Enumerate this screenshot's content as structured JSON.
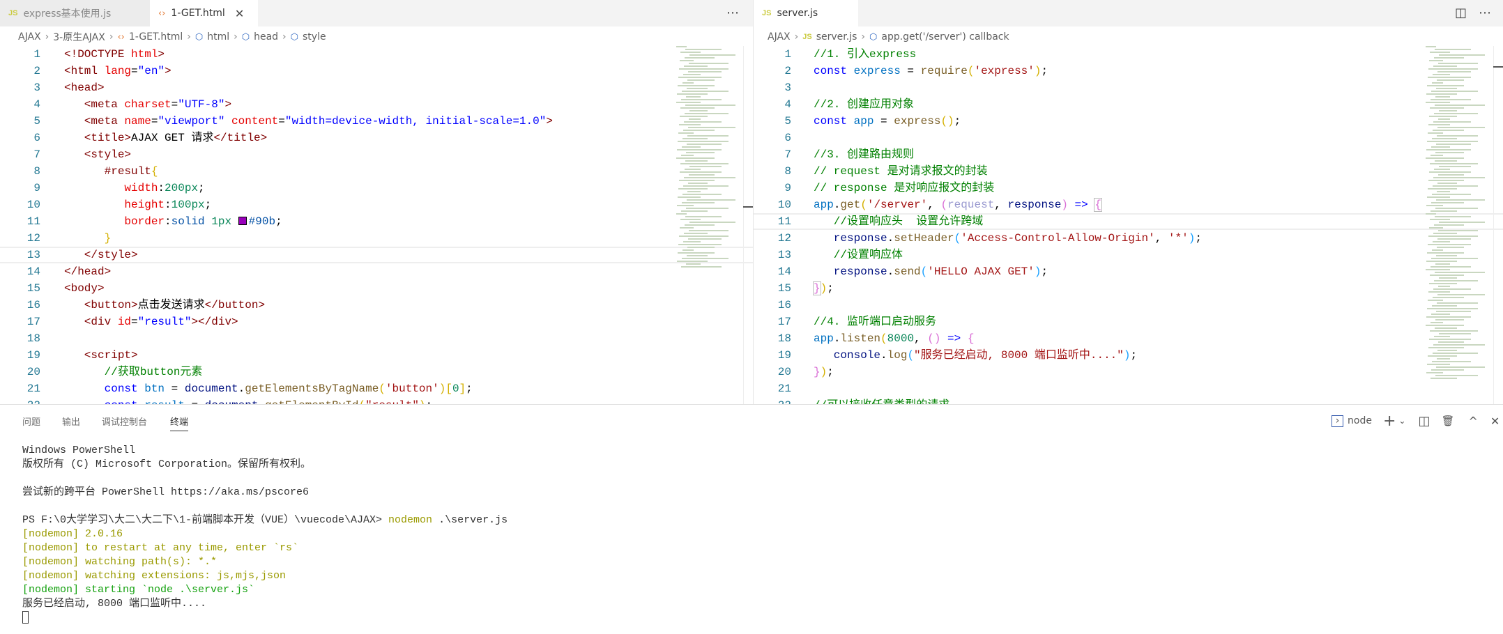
{
  "left_editor": {
    "tabs": [
      {
        "label": "express基本使用.js",
        "icon": "js-icon",
        "active": false
      },
      {
        "label": "1-GET.html",
        "icon": "html-icon",
        "active": true
      }
    ],
    "breadcrumb": [
      "AJAX",
      "3-原生AJAX",
      "1-GET.html",
      "html",
      "head",
      "style"
    ],
    "current_line": 13,
    "lines": [
      {
        "n": "1",
        "tokens": [
          {
            "t": "<!DOCTYPE ",
            "c": "tag"
          },
          {
            "t": "html",
            "c": "attr"
          },
          {
            "t": ">",
            "c": "tag"
          }
        ]
      },
      {
        "n": "2",
        "tokens": [
          {
            "t": "<html ",
            "c": "tag"
          },
          {
            "t": "lang",
            "c": "attr"
          },
          {
            "t": "=",
            "c": "txtc"
          },
          {
            "t": "\"en\"",
            "c": "val"
          },
          {
            "t": ">",
            "c": "tag"
          }
        ]
      },
      {
        "n": "3",
        "tokens": [
          {
            "t": "<head>",
            "c": "tag"
          }
        ]
      },
      {
        "n": "4",
        "tokens": [
          {
            "t": "   <meta ",
            "c": "tag"
          },
          {
            "t": "charset",
            "c": "attr"
          },
          {
            "t": "=",
            "c": "txtc"
          },
          {
            "t": "\"UTF-8\"",
            "c": "val"
          },
          {
            "t": ">",
            "c": "tag"
          }
        ]
      },
      {
        "n": "5",
        "tokens": [
          {
            "t": "   <meta ",
            "c": "tag"
          },
          {
            "t": "name",
            "c": "attr"
          },
          {
            "t": "=",
            "c": "txtc"
          },
          {
            "t": "\"viewport\"",
            "c": "val"
          },
          {
            "t": " content",
            "c": "attr"
          },
          {
            "t": "=",
            "c": "txtc"
          },
          {
            "t": "\"width=device-width, initial-scale=1.0\"",
            "c": "val"
          },
          {
            "t": ">",
            "c": "tag"
          }
        ]
      },
      {
        "n": "6",
        "tokens": [
          {
            "t": "   <title>",
            "c": "tag"
          },
          {
            "t": "AJAX GET 请求",
            "c": "txtc"
          },
          {
            "t": "</title>",
            "c": "tag"
          }
        ]
      },
      {
        "n": "7",
        "tokens": [
          {
            "t": "   <style>",
            "c": "tag"
          }
        ]
      },
      {
        "n": "8",
        "tokens": [
          {
            "t": "      #result",
            "c": "tag"
          },
          {
            "t": "{",
            "c": "b1"
          }
        ]
      },
      {
        "n": "9",
        "tokens": [
          {
            "t": "         width",
            "c": "attr"
          },
          {
            "t": ":",
            "c": "txtc"
          },
          {
            "t": "200px",
            "c": "num"
          },
          {
            "t": ";",
            "c": "txtc"
          }
        ]
      },
      {
        "n": "10",
        "tokens": [
          {
            "t": "         height",
            "c": "attr"
          },
          {
            "t": ":",
            "c": "txtc"
          },
          {
            "t": "100px",
            "c": "num"
          },
          {
            "t": ";",
            "c": "txtc"
          }
        ]
      },
      {
        "n": "11",
        "tokens": [
          {
            "t": "         border",
            "c": "attr"
          },
          {
            "t": ":",
            "c": "txtc"
          },
          {
            "t": "solid ",
            "c": "cval"
          },
          {
            "t": "1px ",
            "c": "num"
          },
          {
            "t": "",
            "c": "swatch",
            "color": "#9900bb"
          },
          {
            "t": "#90b",
            "c": "cval"
          },
          {
            "t": ";",
            "c": "txtc"
          }
        ]
      },
      {
        "n": "12",
        "tokens": [
          {
            "t": "      }",
            "c": "b1"
          }
        ]
      },
      {
        "n": "13",
        "tokens": [
          {
            "t": "   </style>",
            "c": "tag"
          }
        ]
      },
      {
        "n": "14",
        "tokens": [
          {
            "t": "</head>",
            "c": "tag"
          }
        ]
      },
      {
        "n": "15",
        "tokens": [
          {
            "t": "<body>",
            "c": "tag"
          }
        ]
      },
      {
        "n": "16",
        "tokens": [
          {
            "t": "   <button>",
            "c": "tag"
          },
          {
            "t": "点击发送请求",
            "c": "txtc"
          },
          {
            "t": "</button>",
            "c": "tag"
          }
        ]
      },
      {
        "n": "17",
        "tokens": [
          {
            "t": "   <div ",
            "c": "tag"
          },
          {
            "t": "id",
            "c": "attr"
          },
          {
            "t": "=",
            "c": "txtc"
          },
          {
            "t": "\"result\"",
            "c": "val"
          },
          {
            "t": "></div>",
            "c": "tag"
          }
        ]
      },
      {
        "n": "18",
        "tokens": []
      },
      {
        "n": "19",
        "tokens": [
          {
            "t": "   <script>",
            "c": "tag"
          }
        ]
      },
      {
        "n": "20",
        "tokens": [
          {
            "t": "      //获取button元素",
            "c": "cmt"
          }
        ]
      },
      {
        "n": "21",
        "tokens": [
          {
            "t": "      const",
            "c": "kw"
          },
          {
            "t": " btn",
            "c": "cvar"
          },
          {
            "t": " = ",
            "c": "txtc"
          },
          {
            "t": "document",
            "c": "var"
          },
          {
            "t": ".",
            "c": "txtc"
          },
          {
            "t": "getElementsByTagName",
            "c": "fn"
          },
          {
            "t": "(",
            "c": "b1"
          },
          {
            "t": "'button'",
            "c": "str"
          },
          {
            "t": ")",
            "c": "b1"
          },
          {
            "t": "[",
            "c": "b1"
          },
          {
            "t": "0",
            "c": "num"
          },
          {
            "t": "]",
            "c": "b1"
          },
          {
            "t": ";",
            "c": "txtc"
          }
        ]
      },
      {
        "n": "22",
        "tokens": [
          {
            "t": "      const",
            "c": "kw"
          },
          {
            "t": " result",
            "c": "cvar"
          },
          {
            "t": " = ",
            "c": "txtc"
          },
          {
            "t": "document",
            "c": "var"
          },
          {
            "t": ".",
            "c": "txtc"
          },
          {
            "t": "getElementById",
            "c": "fn"
          },
          {
            "t": "(",
            "c": "b1"
          },
          {
            "t": "\"result\"",
            "c": "str"
          },
          {
            "t": ")",
            "c": "b1"
          },
          {
            "t": ";",
            "c": "txtc"
          }
        ]
      }
    ]
  },
  "right_editor": {
    "tabs": [
      {
        "label": "server.js",
        "icon": "js-icon",
        "active": true,
        "unsaved": true
      }
    ],
    "breadcrumb": [
      "AJAX",
      "server.js",
      "app.get('/server') callback"
    ],
    "current_line": 11,
    "lines": [
      {
        "n": "1",
        "tokens": [
          {
            "t": "//1. 引入express",
            "c": "cmt"
          }
        ]
      },
      {
        "n": "2",
        "tokens": [
          {
            "t": "const",
            "c": "kw"
          },
          {
            "t": " express",
            "c": "cvar"
          },
          {
            "t": " = ",
            "c": "txtc"
          },
          {
            "t": "require",
            "c": "fn"
          },
          {
            "t": "(",
            "c": "b1"
          },
          {
            "t": "'express'",
            "c": "str"
          },
          {
            "t": ")",
            "c": "b1"
          },
          {
            "t": ";",
            "c": "txtc"
          }
        ]
      },
      {
        "n": "3",
        "tokens": []
      },
      {
        "n": "4",
        "tokens": [
          {
            "t": "//2. 创建应用对象",
            "c": "cmt"
          }
        ]
      },
      {
        "n": "5",
        "tokens": [
          {
            "t": "const",
            "c": "kw"
          },
          {
            "t": " app",
            "c": "cvar"
          },
          {
            "t": " = ",
            "c": "txtc"
          },
          {
            "t": "express",
            "c": "fn"
          },
          {
            "t": "()",
            "c": "b1"
          },
          {
            "t": ";",
            "c": "txtc"
          }
        ]
      },
      {
        "n": "6",
        "tokens": []
      },
      {
        "n": "7",
        "tokens": [
          {
            "t": "//3. 创建路由规则",
            "c": "cmt"
          }
        ]
      },
      {
        "n": "8",
        "tokens": [
          {
            "t": "// request 是对请求报文的封装",
            "c": "cmt"
          }
        ]
      },
      {
        "n": "9",
        "tokens": [
          {
            "t": "// response 是对响应报文的封装",
            "c": "cmt"
          }
        ]
      },
      {
        "n": "10",
        "tokens": [
          {
            "t": "app",
            "c": "cvar"
          },
          {
            "t": ".",
            "c": "txtc"
          },
          {
            "t": "get",
            "c": "fn"
          },
          {
            "t": "(",
            "c": "b1"
          },
          {
            "t": "'/server'",
            "c": "str"
          },
          {
            "t": ", ",
            "c": "txtc"
          },
          {
            "t": "(",
            "c": "b2"
          },
          {
            "t": "request",
            "c": "unused"
          },
          {
            "t": ", ",
            "c": "txtc"
          },
          {
            "t": "response",
            "c": "var"
          },
          {
            "t": ")",
            "c": "b2"
          },
          {
            "t": " => ",
            "c": "kw"
          },
          {
            "t": "{",
            "c": "b2 box"
          }
        ]
      },
      {
        "n": "11",
        "tokens": [
          {
            "t": "   //设置响应头  设置允许跨域",
            "c": "cmt"
          }
        ]
      },
      {
        "n": "12",
        "tokens": [
          {
            "t": "   response",
            "c": "var"
          },
          {
            "t": ".",
            "c": "txtc"
          },
          {
            "t": "setHeader",
            "c": "fn"
          },
          {
            "t": "(",
            "c": "b3"
          },
          {
            "t": "'Access-Control-Allow-Origin'",
            "c": "str"
          },
          {
            "t": ", ",
            "c": "txtc"
          },
          {
            "t": "'*'",
            "c": "str"
          },
          {
            "t": ")",
            "c": "b3"
          },
          {
            "t": ";",
            "c": "txtc"
          }
        ]
      },
      {
        "n": "13",
        "tokens": [
          {
            "t": "   //设置响应体",
            "c": "cmt"
          }
        ]
      },
      {
        "n": "14",
        "tokens": [
          {
            "t": "   response",
            "c": "var"
          },
          {
            "t": ".",
            "c": "txtc"
          },
          {
            "t": "send",
            "c": "fn"
          },
          {
            "t": "(",
            "c": "b3"
          },
          {
            "t": "'HELLO AJAX GET'",
            "c": "str"
          },
          {
            "t": ")",
            "c": "b3"
          },
          {
            "t": ";",
            "c": "txtc"
          }
        ]
      },
      {
        "n": "15",
        "tokens": [
          {
            "t": "}",
            "c": "b2 box"
          },
          {
            "t": ")",
            "c": "b1"
          },
          {
            "t": ";",
            "c": "txtc"
          }
        ]
      },
      {
        "n": "16",
        "tokens": []
      },
      {
        "n": "17",
        "tokens": [
          {
            "t": "//4. 监听端口启动服务",
            "c": "cmt"
          }
        ]
      },
      {
        "n": "18",
        "tokens": [
          {
            "t": "app",
            "c": "cvar"
          },
          {
            "t": ".",
            "c": "txtc"
          },
          {
            "t": "listen",
            "c": "fn"
          },
          {
            "t": "(",
            "c": "b1"
          },
          {
            "t": "8000",
            "c": "num"
          },
          {
            "t": ", ",
            "c": "txtc"
          },
          {
            "t": "()",
            "c": "b2"
          },
          {
            "t": " => ",
            "c": "kw"
          },
          {
            "t": "{",
            "c": "b2"
          }
        ]
      },
      {
        "n": "19",
        "tokens": [
          {
            "t": "   console",
            "c": "var"
          },
          {
            "t": ".",
            "c": "txtc"
          },
          {
            "t": "log",
            "c": "fn"
          },
          {
            "t": "(",
            "c": "b3"
          },
          {
            "t": "\"服务已经启动, 8000 端口监听中....\"",
            "c": "str"
          },
          {
            "t": ")",
            "c": "b3"
          },
          {
            "t": ";",
            "c": "txtc"
          }
        ]
      },
      {
        "n": "20",
        "tokens": [
          {
            "t": "}",
            "c": "b2"
          },
          {
            "t": ")",
            "c": "b1"
          },
          {
            "t": ";",
            "c": "txtc"
          }
        ]
      },
      {
        "n": "21",
        "tokens": []
      },
      {
        "n": "22",
        "tokens": [
          {
            "t": "//可以接收任意类型的请求",
            "c": "cmt"
          }
        ]
      }
    ]
  },
  "panel": {
    "tabs": [
      {
        "label": "问题",
        "active": false
      },
      {
        "label": "输出",
        "active": false
      },
      {
        "label": "调试控制台",
        "active": false
      },
      {
        "label": "终端",
        "active": true
      }
    ],
    "terminal_name": "node",
    "terminal": [
      [
        {
          "t": "Windows PowerShell",
          "c": ""
        }
      ],
      [
        {
          "t": "版权所有 (C) Microsoft Corporation。保留所有权利。",
          "c": ""
        }
      ],
      [],
      [
        {
          "t": "尝试新的跨平台 PowerShell https://aka.ms/pscore6",
          "c": ""
        }
      ],
      [],
      [
        {
          "t": "PS F:\\0大学学习\\大二\\大二下\\1-前端脚本开发（VUE）\\vuecode\\AJAX> ",
          "c": ""
        },
        {
          "t": "nodemon",
          "c": "ny"
        },
        {
          "t": " .\\server.js",
          "c": ""
        }
      ],
      [
        {
          "t": "[nodemon] 2.0.16",
          "c": "ny"
        }
      ],
      [
        {
          "t": "[nodemon] to restart at any time, enter `rs`",
          "c": "ny"
        }
      ],
      [
        {
          "t": "[nodemon] watching path(s): *.*",
          "c": "ny"
        }
      ],
      [
        {
          "t": "[nodemon] watching extensions: js,mjs,json",
          "c": "ny"
        }
      ],
      [
        {
          "t": "[nodemon] starting `node .\\server.js`",
          "c": "ng"
        }
      ],
      [
        {
          "t": "服务已经启动, 8000 端口监听中....",
          "c": ""
        }
      ]
    ]
  },
  "icons": {
    "more": "⋯",
    "split": "◫",
    "plus": "+",
    "chevron": "⌄",
    "trash": "🗑",
    "maximize": "^",
    "close": "✕",
    "terminal": "›"
  }
}
